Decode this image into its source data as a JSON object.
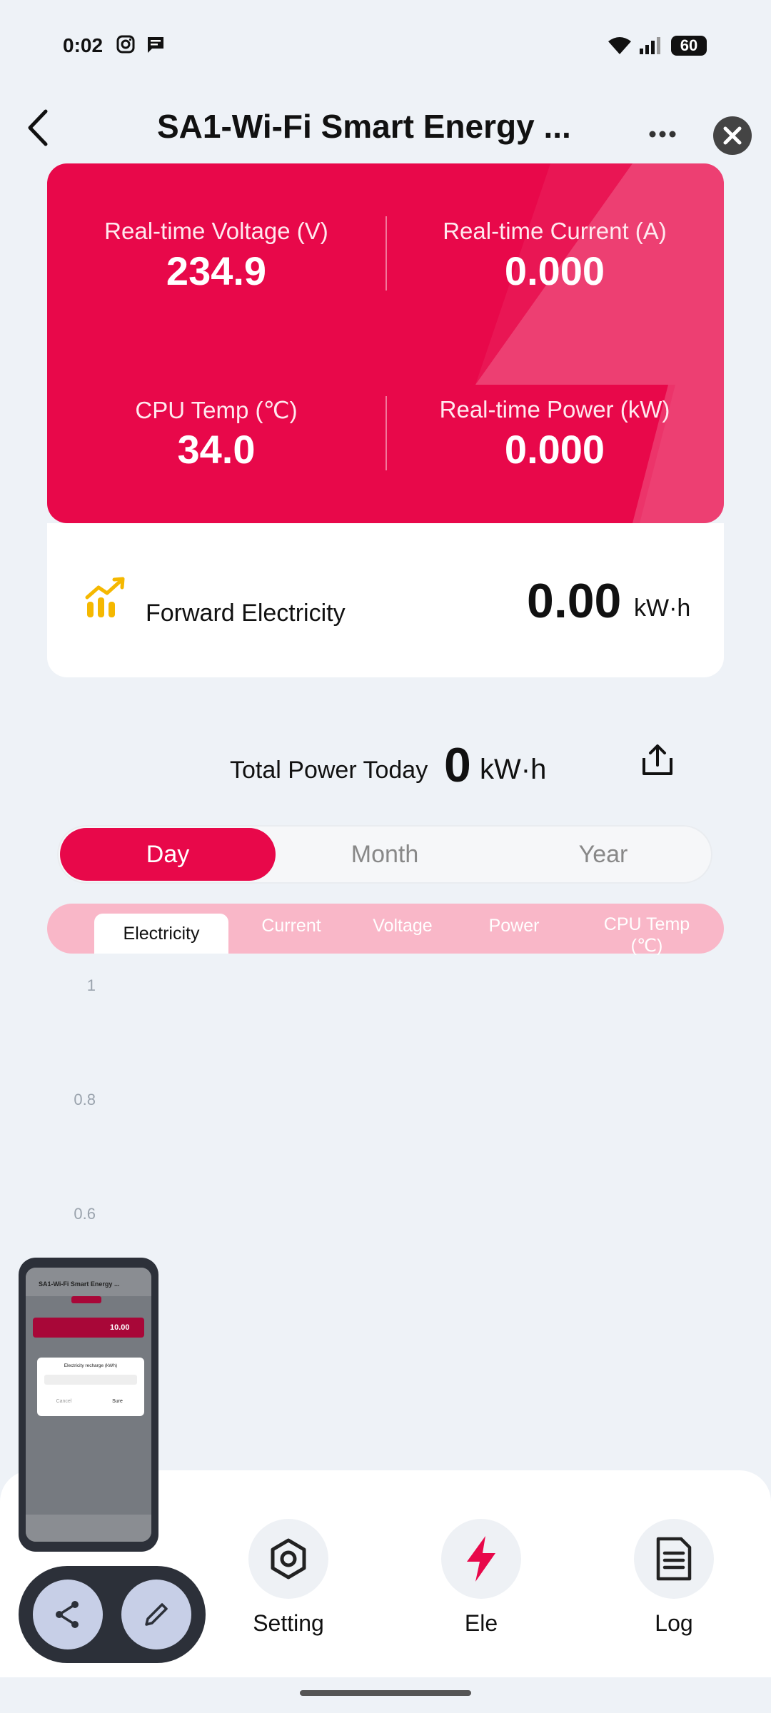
{
  "status": {
    "time": "0:02",
    "battery": "60"
  },
  "header": {
    "title": "SA1-Wi-Fi Smart Energy ..."
  },
  "metrics": [
    {
      "label": "Real-time Voltage (V)",
      "value": "234.9"
    },
    {
      "label": "Real-time Current (A)",
      "value": "0.000"
    },
    {
      "label": "CPU Temp (℃)",
      "value": "34.0"
    },
    {
      "label": "Real-time Power (kW)",
      "value": "0.000"
    }
  ],
  "forward": {
    "label": "Forward Electricity",
    "value": "0.00",
    "unit": "kW·h"
  },
  "today": {
    "label": "Total Power Today",
    "value": "0",
    "unit": "kW·h"
  },
  "periods": [
    "Day",
    "Month",
    "Year"
  ],
  "subtabs": [
    "Electricity",
    "Current",
    "Voltage",
    "Power",
    "CPU Temp\n(℃)"
  ],
  "chart": {
    "yticks": [
      "1",
      "0.8",
      "0.6"
    ]
  },
  "nav": [
    "Setting",
    "Ele",
    "Log"
  ],
  "pip": {
    "title": "SA1-Wi-Fi Smart Energy ...",
    "dialog_title": "Electricity recharge (kWh)",
    "cancel": "Cancel",
    "sure": "Sure",
    "value": "10.00"
  },
  "colors": {
    "accent": "#e8084a",
    "subtab_bg": "#f9b7c8"
  }
}
